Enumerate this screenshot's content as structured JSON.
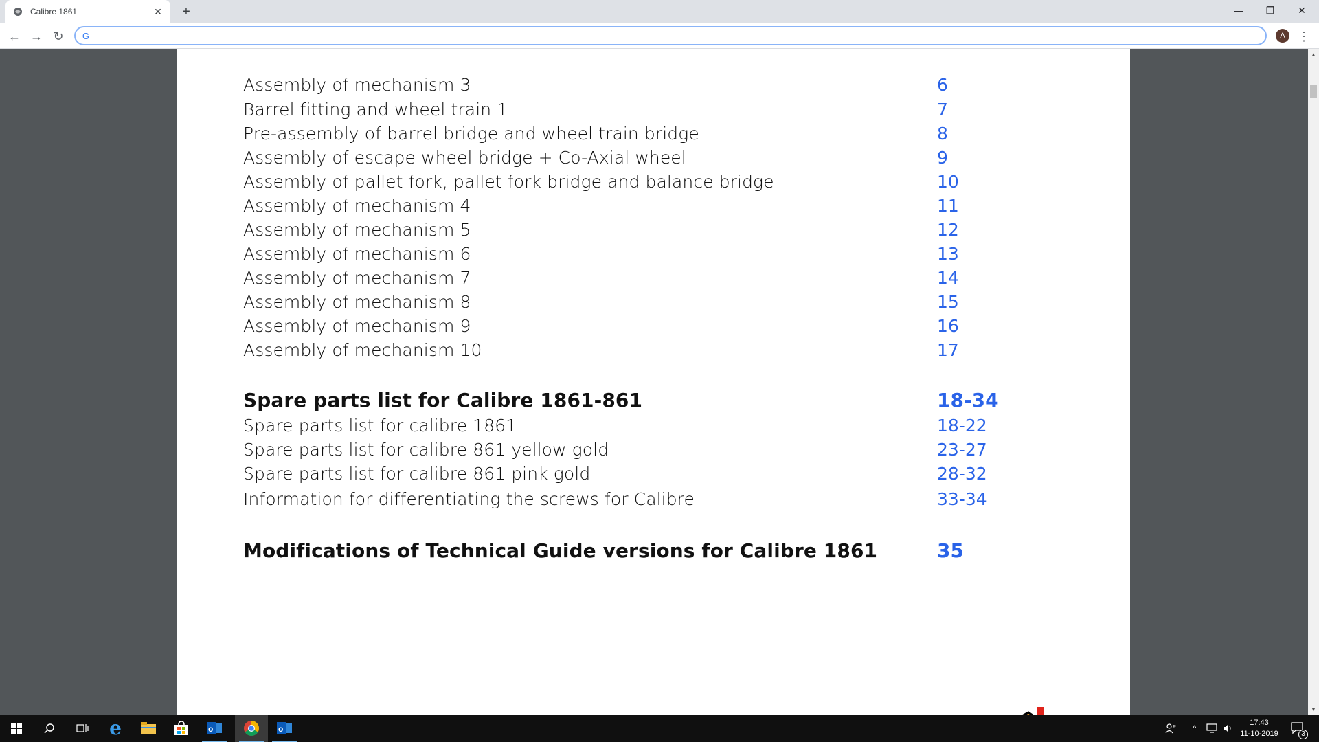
{
  "browser": {
    "tab_title": "Calibre 1861",
    "omnibox_value": "",
    "avatar_letter": "A"
  },
  "toc": {
    "rows": [
      {
        "label": "Assembly of mechanism 3",
        "page": "6",
        "heading": false
      },
      {
        "label": "Barrel fitting and wheel train 1",
        "page": "7",
        "heading": false
      },
      {
        "label": "Pre-assembly of barrel bridge and wheel train bridge",
        "page": "8",
        "heading": false
      },
      {
        "label": "Assembly of escape wheel bridge + Co-Axial wheel",
        "page": "9",
        "heading": false
      },
      {
        "label": "Assembly of pallet fork, pallet fork bridge and balance bridge",
        "page": "10",
        "heading": false
      },
      {
        "label": "Assembly of mechanism 4",
        "page": "11",
        "heading": false
      },
      {
        "label": "Assembly of mechanism 5",
        "page": "12",
        "heading": false
      },
      {
        "label": "Assembly of mechanism 6",
        "page": "13",
        "heading": false
      },
      {
        "label": "Assembly of mechanism 7",
        "page": "14",
        "heading": false
      },
      {
        "label": "Assembly of mechanism 8",
        "page": "15",
        "heading": false
      },
      {
        "label": "Assembly of mechanism 9",
        "page": "16",
        "heading": false
      },
      {
        "label": "Assembly of mechanism 10",
        "page": "17",
        "heading": false
      },
      {
        "label": "Spare parts list for Calibre 1861-861",
        "page": "18-34",
        "heading": true
      },
      {
        "label": "Spare parts list for calibre 1861",
        "page": "18-22",
        "heading": false
      },
      {
        "label": "Spare parts list for calibre 861 yellow gold",
        "page": "23-27",
        "heading": false
      },
      {
        "label": "Spare parts list for calibre 861 pink gold",
        "page": "28-32",
        "heading": false
      },
      {
        "label": "Information for differentiating the screws for Calibre",
        "page": "33-34",
        "heading": false
      },
      {
        "label": "Modifications of Technical Guide versions for Calibre 1861",
        "page": "35",
        "heading": true
      }
    ]
  },
  "taskbar": {
    "time": "17:43",
    "date": "11-10-2019",
    "notification_count": "3"
  },
  "colors": {
    "link_blue": "#2a63e8",
    "viewer_bg": "#525659",
    "taskbar_bg": "#101010"
  }
}
